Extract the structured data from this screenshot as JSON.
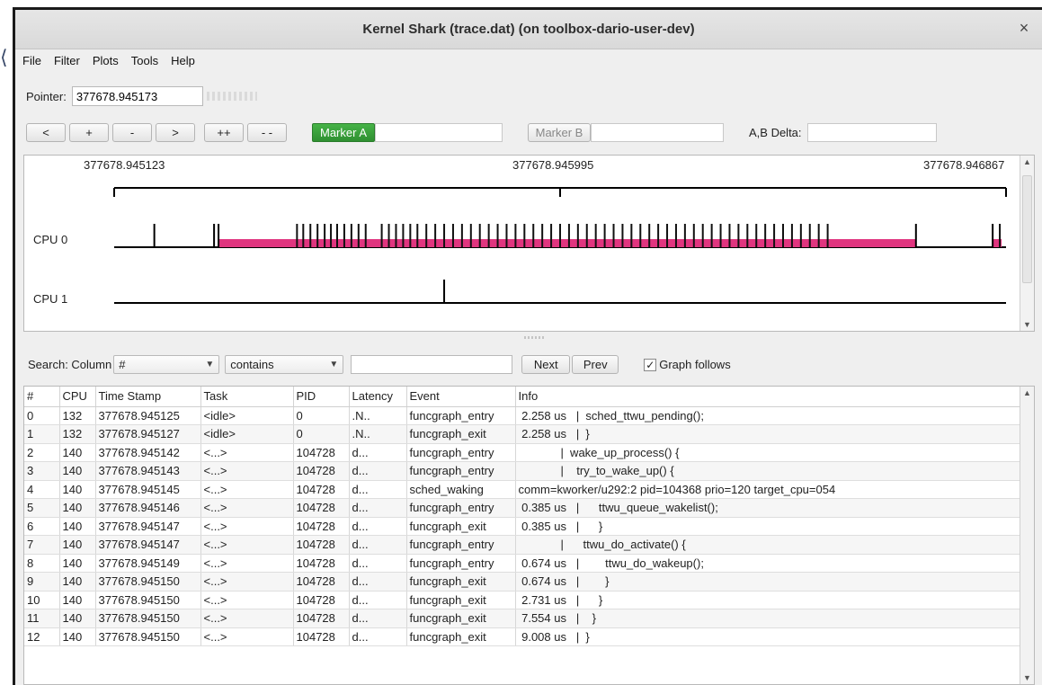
{
  "window": {
    "title": "Kernel Shark (trace.dat) (on toolbox-dario-user-dev)",
    "close_glyph": "×"
  },
  "menu": [
    "File",
    "Filter",
    "Plots",
    "Tools",
    "Help"
  ],
  "pointer": {
    "label": "Pointer:",
    "value": "377678.945173"
  },
  "nav_buttons": [
    "<",
    "+",
    "-",
    ">",
    "++",
    "- -"
  ],
  "markers": {
    "a_label": "Marker A",
    "b_label": "Marker B",
    "delta_label": "A,B Delta:"
  },
  "graph": {
    "time_left": "377678.945123",
    "time_mid": "377678.945995",
    "time_right": "377678.946867",
    "cpu0_label": "CPU 0",
    "cpu1_label": "CPU 1",
    "colors": {
      "task": "#e0357f",
      "line": "#000000"
    },
    "cpu0_spikes": [
      0.045,
      0.112,
      0.117,
      0.205,
      0.212,
      0.22,
      0.228,
      0.236,
      0.243,
      0.25,
      0.258,
      0.266,
      0.274,
      0.282,
      0.3,
      0.308,
      0.316,
      0.324,
      0.332,
      0.34,
      0.35,
      0.36,
      0.37,
      0.38,
      0.39,
      0.4,
      0.41,
      0.42,
      0.43,
      0.44,
      0.45,
      0.46,
      0.47,
      0.48,
      0.49,
      0.5,
      0.51,
      0.52,
      0.53,
      0.54,
      0.55,
      0.56,
      0.57,
      0.58,
      0.59,
      0.6,
      0.61,
      0.62,
      0.63,
      0.64,
      0.65,
      0.66,
      0.67,
      0.68,
      0.69,
      0.7,
      0.71,
      0.72,
      0.73,
      0.74,
      0.75,
      0.76,
      0.77,
      0.78,
      0.79,
      0.8,
      0.899,
      0.985,
      0.993
    ],
    "cpu0_busy": [
      [
        0.117,
        0.899
      ],
      [
        0.985,
        0.995
      ]
    ],
    "cpu1_spikes": [
      0.37
    ]
  },
  "search": {
    "label": "Search: Column",
    "column_value": "#",
    "mode_value": "contains",
    "next_label": "Next",
    "prev_label": "Prev",
    "graph_follows_label": "Graph follows",
    "check_glyph": "✓"
  },
  "table": {
    "columns": [
      "#",
      "CPU",
      "Time Stamp",
      "Task",
      "PID",
      "Latency",
      "Event",
      "Info"
    ],
    "rows": [
      [
        "0",
        "132",
        "377678.945125",
        "<idle>",
        "0",
        ".N..",
        "funcgraph_entry",
        " 2.258 us   |  sched_ttwu_pending();"
      ],
      [
        "1",
        "132",
        "377678.945127",
        "<idle>",
        "0",
        ".N..",
        "funcgraph_exit",
        " 2.258 us   |  }"
      ],
      [
        "2",
        "140",
        "377678.945142",
        "<...>",
        "104728",
        "d...",
        "funcgraph_entry",
        "             |  wake_up_process() {"
      ],
      [
        "3",
        "140",
        "377678.945143",
        "<...>",
        "104728",
        "d...",
        "funcgraph_entry",
        "             |    try_to_wake_up() {"
      ],
      [
        "4",
        "140",
        "377678.945145",
        "<...>",
        "104728",
        "d...",
        "sched_waking",
        "comm=kworker/u292:2 pid=104368 prio=120 target_cpu=054"
      ],
      [
        "5",
        "140",
        "377678.945146",
        "<...>",
        "104728",
        "d...",
        "funcgraph_entry",
        " 0.385 us   |      ttwu_queue_wakelist();"
      ],
      [
        "6",
        "140",
        "377678.945147",
        "<...>",
        "104728",
        "d...",
        "funcgraph_exit",
        " 0.385 us   |      }"
      ],
      [
        "7",
        "140",
        "377678.945147",
        "<...>",
        "104728",
        "d...",
        "funcgraph_entry",
        "             |      ttwu_do_activate() {"
      ],
      [
        "8",
        "140",
        "377678.945149",
        "<...>",
        "104728",
        "d...",
        "funcgraph_entry",
        " 0.674 us   |        ttwu_do_wakeup();"
      ],
      [
        "9",
        "140",
        "377678.945150",
        "<...>",
        "104728",
        "d...",
        "funcgraph_exit",
        " 0.674 us   |        }"
      ],
      [
        "10",
        "140",
        "377678.945150",
        "<...>",
        "104728",
        "d...",
        "funcgraph_exit",
        " 2.731 us   |      }"
      ],
      [
        "11",
        "140",
        "377678.945150",
        "<...>",
        "104728",
        "d...",
        "funcgraph_exit",
        " 7.554 us   |    }"
      ],
      [
        "12",
        "140",
        "377678.945150",
        "<...>",
        "104728",
        "d...",
        "funcgraph_exit",
        " 9.008 us   |  }"
      ]
    ]
  }
}
